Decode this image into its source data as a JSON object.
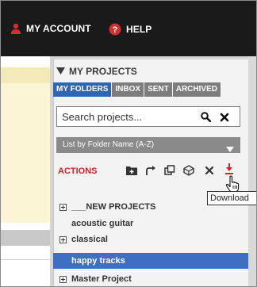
{
  "header": {
    "account_label": "MY ACCOUNT",
    "help_label": "HELP",
    "icon_color": "#d32f2f"
  },
  "projects": {
    "title": "MY PROJECTS",
    "tabs": [
      {
        "label": "MY FOLDERS",
        "active": true
      },
      {
        "label": "INBOX",
        "active": false
      },
      {
        "label": "SENT",
        "active": false
      },
      {
        "label": "ARCHIVED",
        "active": false
      }
    ],
    "search": {
      "placeholder": "Search projects..."
    },
    "sort": {
      "selected": "List by Folder Name (A-Z)"
    },
    "actions": {
      "label": "ACTIONS",
      "icons": [
        "add-folder-icon",
        "move-icon",
        "duplicate-icon",
        "share-icon",
        "delete-icon",
        "download-icon"
      ],
      "tooltip": "Download"
    },
    "tree": [
      {
        "label": "___NEW PROJECTS",
        "expandable": true,
        "selected": false
      },
      {
        "label": "acoustic guitar",
        "expandable": false,
        "selected": false
      },
      {
        "label": "classical",
        "expandable": true,
        "selected": false
      },
      {
        "label": "happy tracks",
        "expandable": false,
        "selected": true
      },
      {
        "label": "Master Project",
        "expandable": true,
        "selected": false
      }
    ]
  },
  "colors": {
    "accent_blue": "#2f66b3",
    "selected_row": "#3f6fc2",
    "actions_red": "#c62828",
    "topbar": "#1a1a1a"
  }
}
